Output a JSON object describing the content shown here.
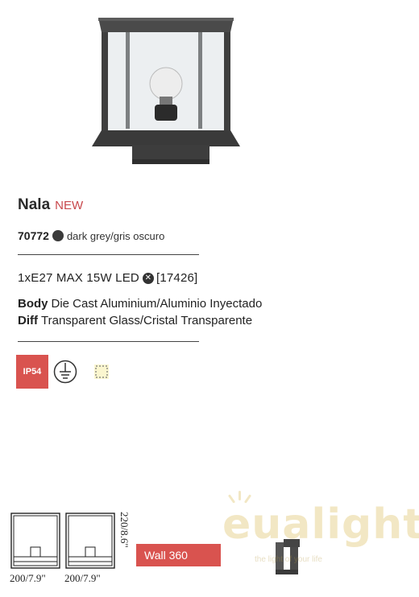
{
  "product": {
    "name": "Nala",
    "badge": "NEW",
    "ref_code": "70772",
    "color_swatch": "#3b3b3b",
    "color_label": "dark grey/gris oscuro"
  },
  "lamp": {
    "prefix": "1xE27 MAX 15W LED",
    "ref": "[17426]"
  },
  "specs": {
    "body_key": "Body",
    "body_value": "Die Cast Aluminium/Aluminio Inyectado",
    "diff_key": "Diff",
    "diff_value": "Transparent Glass/Cristal Transparente"
  },
  "icons": {
    "ip_rating": "IP54",
    "ip_color": "#d9534f"
  },
  "dimensions": {
    "width_1": "200/7.9\"",
    "width_2": "200/7.9\"",
    "height": "220/8.6\""
  },
  "mounting": {
    "label": "Wall 360"
  },
  "watermark": {
    "brand": "eualight",
    "tagline": "the light of your life"
  }
}
